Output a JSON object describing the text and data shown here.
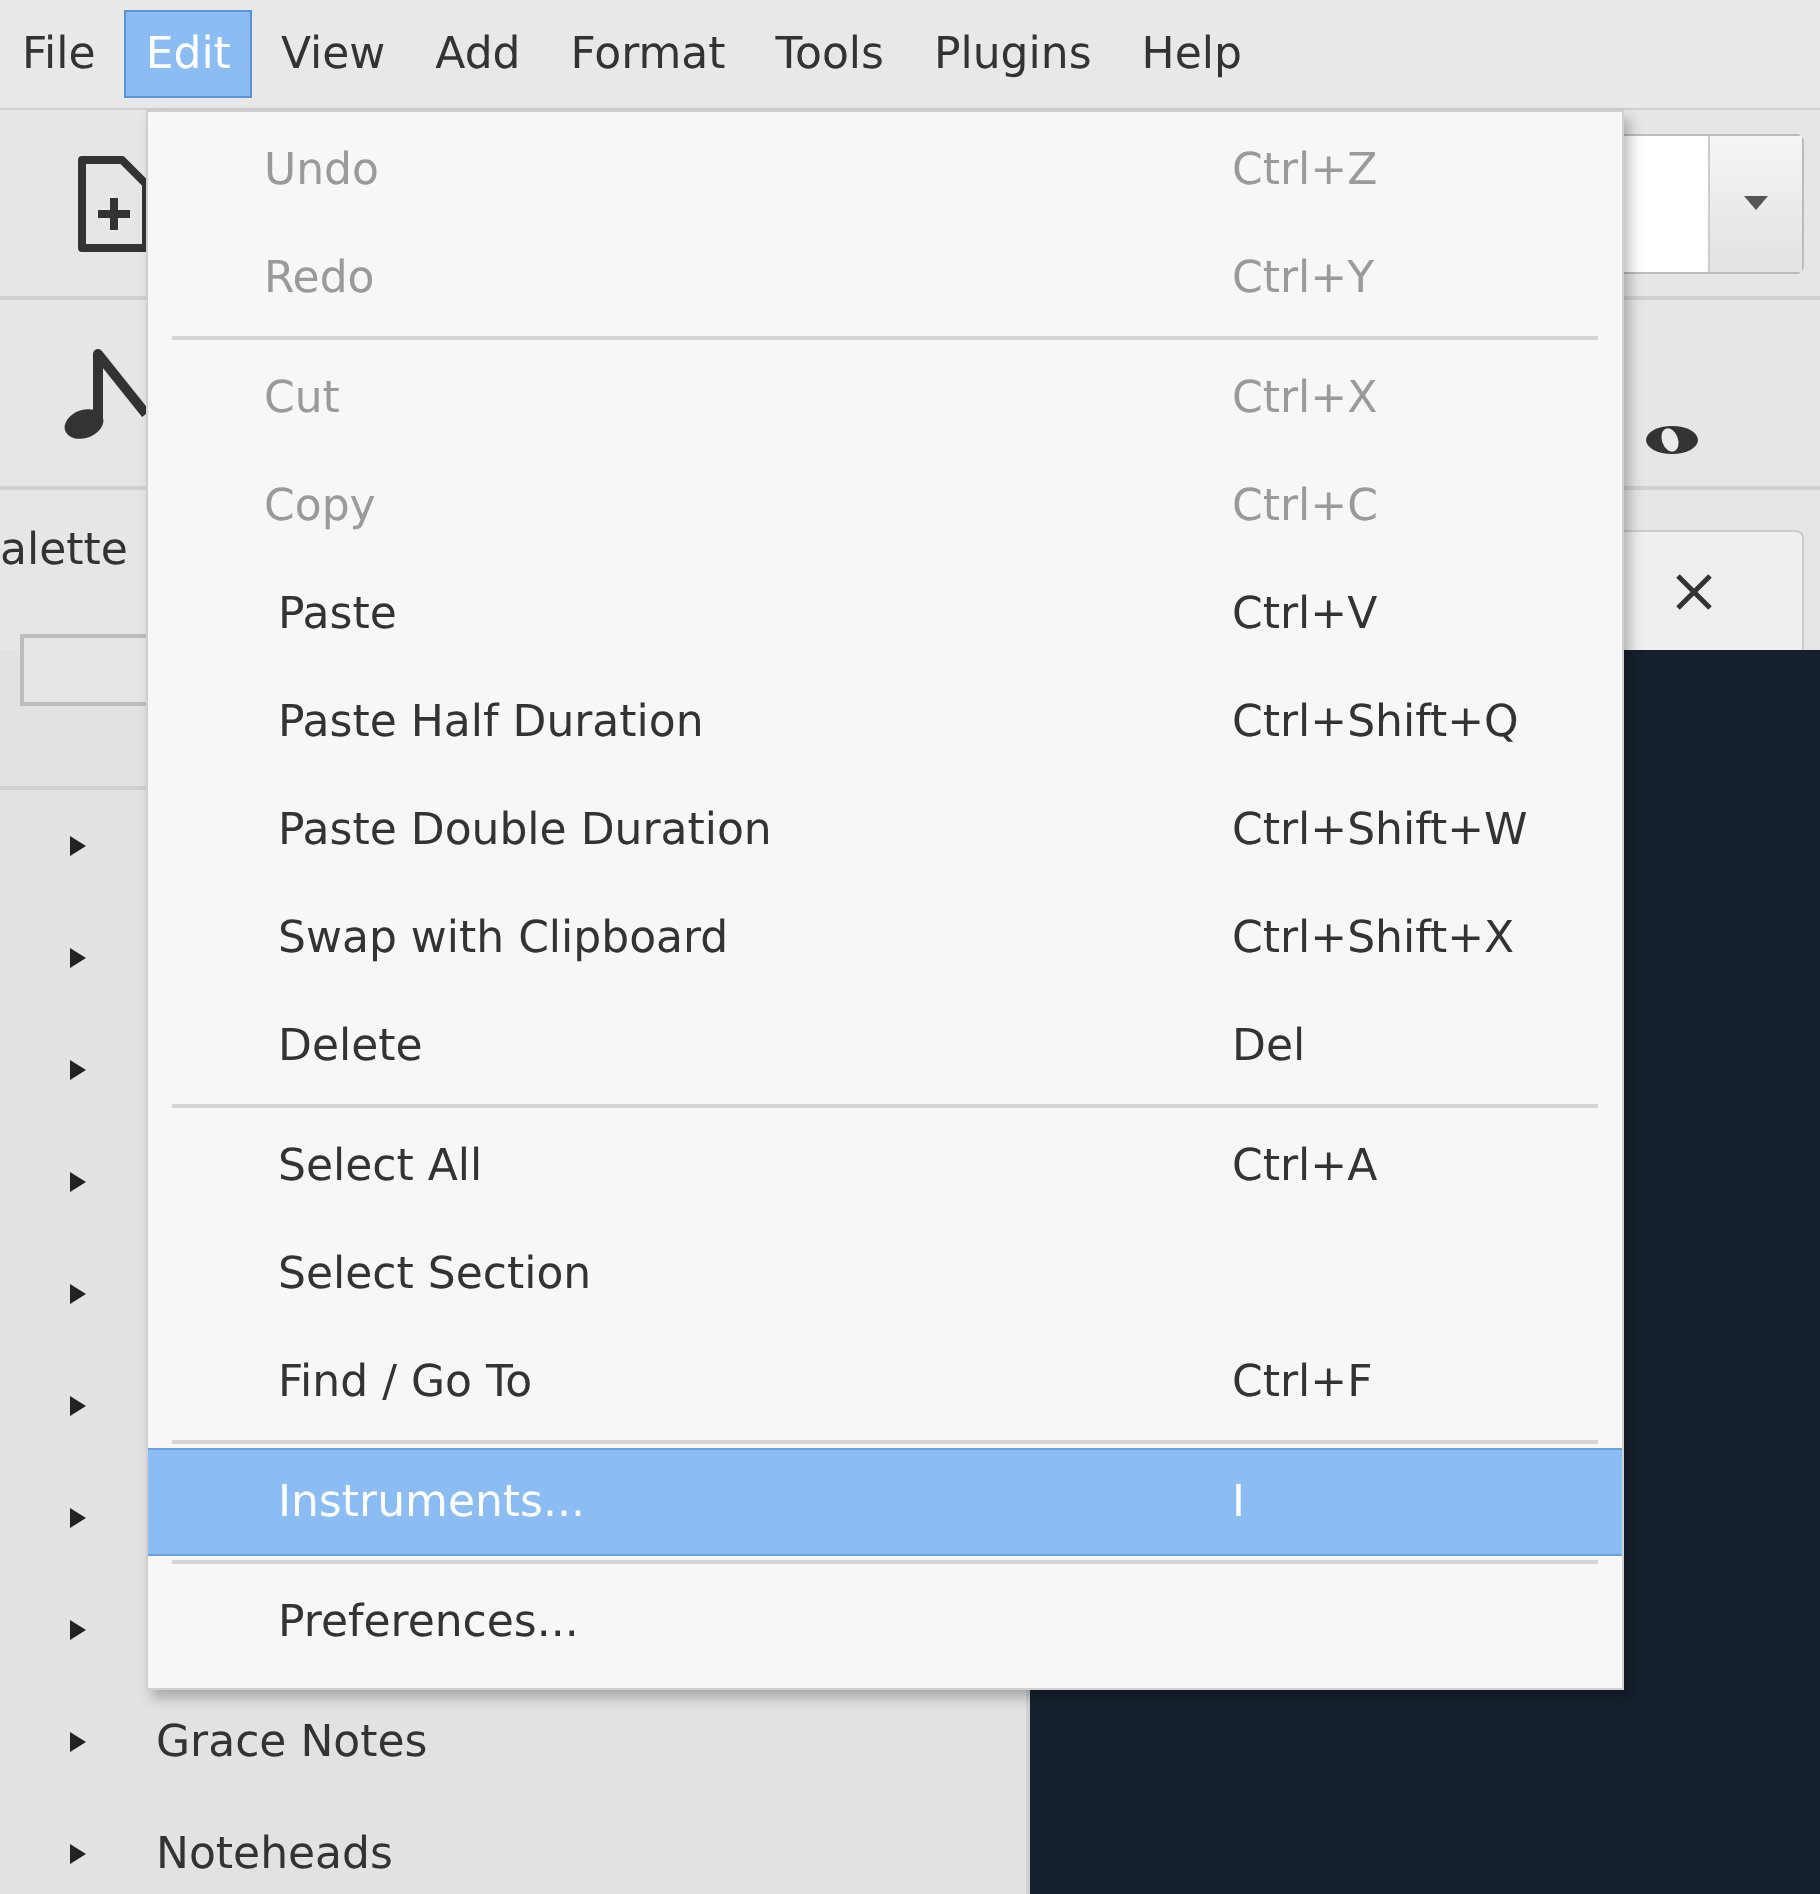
{
  "menubar": [
    {
      "label": "File",
      "selected": false
    },
    {
      "label": "Edit",
      "selected": true
    },
    {
      "label": "View",
      "selected": false
    },
    {
      "label": "Add",
      "selected": false
    },
    {
      "label": "Format",
      "selected": false
    },
    {
      "label": "Tools",
      "selected": false
    },
    {
      "label": "Plugins",
      "selected": false
    },
    {
      "label": "Help",
      "selected": false
    }
  ],
  "edit_menu": [
    {
      "kind": "item",
      "label": "Undo",
      "shortcut": "Ctrl+Z",
      "disabled": true,
      "selected": false
    },
    {
      "kind": "item",
      "label": "Redo",
      "shortcut": "Ctrl+Y",
      "disabled": true,
      "selected": false
    },
    {
      "kind": "separator"
    },
    {
      "kind": "item",
      "label": "Cut",
      "shortcut": "Ctrl+X",
      "disabled": true,
      "selected": false
    },
    {
      "kind": "item",
      "label": "Copy",
      "shortcut": "Ctrl+C",
      "disabled": true,
      "selected": false
    },
    {
      "kind": "item",
      "label": "Paste",
      "shortcut": "Ctrl+V",
      "disabled": false,
      "selected": false
    },
    {
      "kind": "item",
      "label": "Paste Half Duration",
      "shortcut": "Ctrl+Shift+Q",
      "disabled": false,
      "selected": false
    },
    {
      "kind": "item",
      "label": "Paste Double Duration",
      "shortcut": "Ctrl+Shift+W",
      "disabled": false,
      "selected": false
    },
    {
      "kind": "item",
      "label": "Swap with Clipboard",
      "shortcut": "Ctrl+Shift+X",
      "disabled": false,
      "selected": false
    },
    {
      "kind": "item",
      "label": "Delete",
      "shortcut": "Del",
      "disabled": false,
      "selected": false
    },
    {
      "kind": "separator"
    },
    {
      "kind": "item",
      "label": "Select All",
      "shortcut": "Ctrl+A",
      "disabled": false,
      "selected": false
    },
    {
      "kind": "item",
      "label": "Select Section",
      "disabled": false,
      "selected": false
    },
    {
      "kind": "item",
      "label": "Find / Go To",
      "shortcut": "Ctrl+F",
      "disabled": false,
      "selected": false
    },
    {
      "kind": "separator"
    },
    {
      "kind": "item",
      "label": "Instruments...",
      "shortcut": "I",
      "disabled": false,
      "selected": true
    },
    {
      "kind": "separator"
    },
    {
      "kind": "item",
      "label": "Preferences...",
      "disabled": false,
      "selected": false
    }
  ],
  "palette_panel": {
    "title": "alette",
    "items": [
      {
        "expanded": false
      },
      {
        "expanded": false
      },
      {
        "expanded": false
      },
      {
        "expanded": false
      },
      {
        "expanded": false
      },
      {
        "expanded": false
      },
      {
        "expanded": false
      },
      {
        "expanded": false
      },
      {
        "label": "Grace Notes",
        "expanded": false
      },
      {
        "label": "Noteheads",
        "expanded": false
      }
    ]
  }
}
